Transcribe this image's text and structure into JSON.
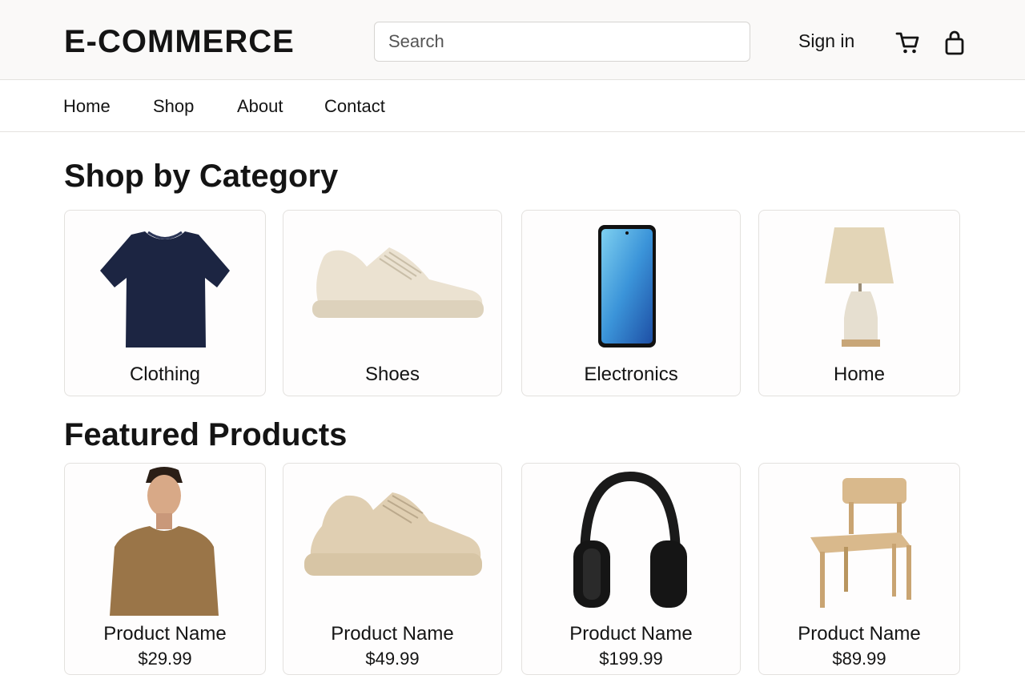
{
  "header": {
    "logo": "E-COMMERCE",
    "search_placeholder": "Search",
    "signin_label": "Sign in",
    "icons": [
      "cart-icon",
      "bag-icon"
    ]
  },
  "nav": {
    "items": [
      {
        "label": "Home"
      },
      {
        "label": "Shop"
      },
      {
        "label": "About"
      },
      {
        "label": "Contact"
      }
    ]
  },
  "categories": {
    "title": "Shop by Category",
    "items": [
      {
        "label": "Clothing",
        "image": "navy-tshirt"
      },
      {
        "label": "Shoes",
        "image": "beige-sneaker"
      },
      {
        "label": "Electronics",
        "image": "smartphone"
      },
      {
        "label": "Home",
        "image": "table-lamp"
      }
    ]
  },
  "featured": {
    "title": "Featured Products",
    "items": [
      {
        "name": "Product Name",
        "price": "$29.99",
        "image": "man-in-brown-sweater"
      },
      {
        "name": "Product Name",
        "price": "$49.99",
        "image": "beige-chunky-sneaker"
      },
      {
        "name": "Product Name",
        "price": "$199.99",
        "image": "black-headphones"
      },
      {
        "name": "Product Name",
        "price": "$89.99",
        "image": "wooden-chair"
      }
    ]
  },
  "colors": {
    "header_bg": "#faf9f8",
    "text": "#141414",
    "border": "#e3e1de",
    "navy": "#1c2542",
    "beige": "#e6dcc8",
    "phone_blue": "#3b94d9",
    "sweater_brown": "#9a7548",
    "wood": "#d9b98c"
  }
}
